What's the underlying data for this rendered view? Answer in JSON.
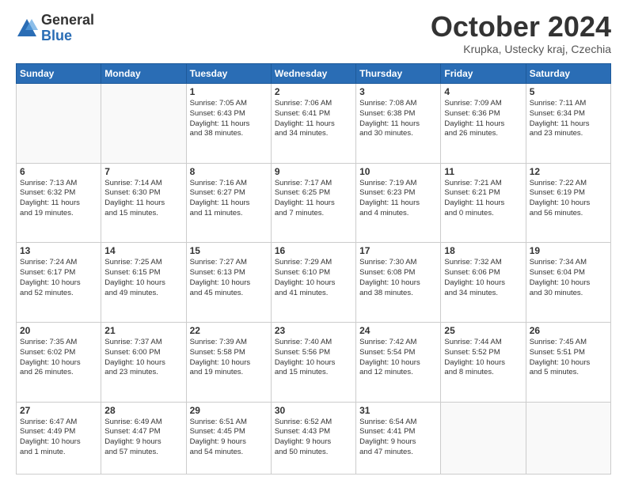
{
  "header": {
    "logo_general": "General",
    "logo_blue": "Blue",
    "month_title": "October 2024",
    "location": "Krupka, Ustecky kraj, Czechia"
  },
  "weekdays": [
    "Sunday",
    "Monday",
    "Tuesday",
    "Wednesday",
    "Thursday",
    "Friday",
    "Saturday"
  ],
  "weeks": [
    [
      {
        "day": "",
        "lines": []
      },
      {
        "day": "",
        "lines": []
      },
      {
        "day": "1",
        "lines": [
          "Sunrise: 7:05 AM",
          "Sunset: 6:43 PM",
          "Daylight: 11 hours",
          "and 38 minutes."
        ]
      },
      {
        "day": "2",
        "lines": [
          "Sunrise: 7:06 AM",
          "Sunset: 6:41 PM",
          "Daylight: 11 hours",
          "and 34 minutes."
        ]
      },
      {
        "day": "3",
        "lines": [
          "Sunrise: 7:08 AM",
          "Sunset: 6:38 PM",
          "Daylight: 11 hours",
          "and 30 minutes."
        ]
      },
      {
        "day": "4",
        "lines": [
          "Sunrise: 7:09 AM",
          "Sunset: 6:36 PM",
          "Daylight: 11 hours",
          "and 26 minutes."
        ]
      },
      {
        "day": "5",
        "lines": [
          "Sunrise: 7:11 AM",
          "Sunset: 6:34 PM",
          "Daylight: 11 hours",
          "and 23 minutes."
        ]
      }
    ],
    [
      {
        "day": "6",
        "lines": [
          "Sunrise: 7:13 AM",
          "Sunset: 6:32 PM",
          "Daylight: 11 hours",
          "and 19 minutes."
        ]
      },
      {
        "day": "7",
        "lines": [
          "Sunrise: 7:14 AM",
          "Sunset: 6:30 PM",
          "Daylight: 11 hours",
          "and 15 minutes."
        ]
      },
      {
        "day": "8",
        "lines": [
          "Sunrise: 7:16 AM",
          "Sunset: 6:27 PM",
          "Daylight: 11 hours",
          "and 11 minutes."
        ]
      },
      {
        "day": "9",
        "lines": [
          "Sunrise: 7:17 AM",
          "Sunset: 6:25 PM",
          "Daylight: 11 hours",
          "and 7 minutes."
        ]
      },
      {
        "day": "10",
        "lines": [
          "Sunrise: 7:19 AM",
          "Sunset: 6:23 PM",
          "Daylight: 11 hours",
          "and 4 minutes."
        ]
      },
      {
        "day": "11",
        "lines": [
          "Sunrise: 7:21 AM",
          "Sunset: 6:21 PM",
          "Daylight: 11 hours",
          "and 0 minutes."
        ]
      },
      {
        "day": "12",
        "lines": [
          "Sunrise: 7:22 AM",
          "Sunset: 6:19 PM",
          "Daylight: 10 hours",
          "and 56 minutes."
        ]
      }
    ],
    [
      {
        "day": "13",
        "lines": [
          "Sunrise: 7:24 AM",
          "Sunset: 6:17 PM",
          "Daylight: 10 hours",
          "and 52 minutes."
        ]
      },
      {
        "day": "14",
        "lines": [
          "Sunrise: 7:25 AM",
          "Sunset: 6:15 PM",
          "Daylight: 10 hours",
          "and 49 minutes."
        ]
      },
      {
        "day": "15",
        "lines": [
          "Sunrise: 7:27 AM",
          "Sunset: 6:13 PM",
          "Daylight: 10 hours",
          "and 45 minutes."
        ]
      },
      {
        "day": "16",
        "lines": [
          "Sunrise: 7:29 AM",
          "Sunset: 6:10 PM",
          "Daylight: 10 hours",
          "and 41 minutes."
        ]
      },
      {
        "day": "17",
        "lines": [
          "Sunrise: 7:30 AM",
          "Sunset: 6:08 PM",
          "Daylight: 10 hours",
          "and 38 minutes."
        ]
      },
      {
        "day": "18",
        "lines": [
          "Sunrise: 7:32 AM",
          "Sunset: 6:06 PM",
          "Daylight: 10 hours",
          "and 34 minutes."
        ]
      },
      {
        "day": "19",
        "lines": [
          "Sunrise: 7:34 AM",
          "Sunset: 6:04 PM",
          "Daylight: 10 hours",
          "and 30 minutes."
        ]
      }
    ],
    [
      {
        "day": "20",
        "lines": [
          "Sunrise: 7:35 AM",
          "Sunset: 6:02 PM",
          "Daylight: 10 hours",
          "and 26 minutes."
        ]
      },
      {
        "day": "21",
        "lines": [
          "Sunrise: 7:37 AM",
          "Sunset: 6:00 PM",
          "Daylight: 10 hours",
          "and 23 minutes."
        ]
      },
      {
        "day": "22",
        "lines": [
          "Sunrise: 7:39 AM",
          "Sunset: 5:58 PM",
          "Daylight: 10 hours",
          "and 19 minutes."
        ]
      },
      {
        "day": "23",
        "lines": [
          "Sunrise: 7:40 AM",
          "Sunset: 5:56 PM",
          "Daylight: 10 hours",
          "and 15 minutes."
        ]
      },
      {
        "day": "24",
        "lines": [
          "Sunrise: 7:42 AM",
          "Sunset: 5:54 PM",
          "Daylight: 10 hours",
          "and 12 minutes."
        ]
      },
      {
        "day": "25",
        "lines": [
          "Sunrise: 7:44 AM",
          "Sunset: 5:52 PM",
          "Daylight: 10 hours",
          "and 8 minutes."
        ]
      },
      {
        "day": "26",
        "lines": [
          "Sunrise: 7:45 AM",
          "Sunset: 5:51 PM",
          "Daylight: 10 hours",
          "and 5 minutes."
        ]
      }
    ],
    [
      {
        "day": "27",
        "lines": [
          "Sunrise: 6:47 AM",
          "Sunset: 4:49 PM",
          "Daylight: 10 hours",
          "and 1 minute."
        ]
      },
      {
        "day": "28",
        "lines": [
          "Sunrise: 6:49 AM",
          "Sunset: 4:47 PM",
          "Daylight: 9 hours",
          "and 57 minutes."
        ]
      },
      {
        "day": "29",
        "lines": [
          "Sunrise: 6:51 AM",
          "Sunset: 4:45 PM",
          "Daylight: 9 hours",
          "and 54 minutes."
        ]
      },
      {
        "day": "30",
        "lines": [
          "Sunrise: 6:52 AM",
          "Sunset: 4:43 PM",
          "Daylight: 9 hours",
          "and 50 minutes."
        ]
      },
      {
        "day": "31",
        "lines": [
          "Sunrise: 6:54 AM",
          "Sunset: 4:41 PM",
          "Daylight: 9 hours",
          "and 47 minutes."
        ]
      },
      {
        "day": "",
        "lines": []
      },
      {
        "day": "",
        "lines": []
      }
    ]
  ]
}
